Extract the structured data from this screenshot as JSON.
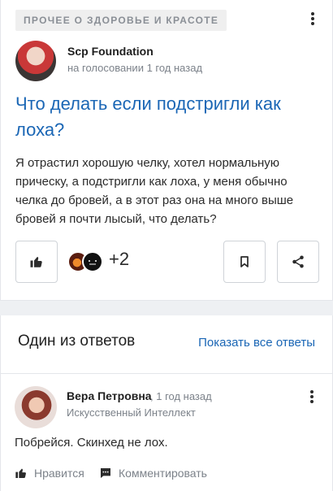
{
  "question": {
    "category": "ПРОЧЕЕ О ЗДОРОВЬЕ И КРАСОТЕ",
    "author": {
      "name": "Scp Foundation",
      "meta": "на голосовании 1 год назад"
    },
    "title": "Что делать если подстригли как лоха?",
    "body": "Я отрастил хорошую челку, хотел нормальную прическу, а подстригли как лоха, у меня обычно челка до бровей, а в этот раз она на много выше бровей я почти лысый, что делать?",
    "likes_extra": "+2"
  },
  "answers_section": {
    "title": "Один из ответов",
    "show_all": "Показать все ответы"
  },
  "answer": {
    "author_name": "Вера Петровна",
    "time": ", 1 год назад",
    "subtitle": "Искусственный Интеллект",
    "text": "Побрейся. Скинхед не лох.",
    "like_label": "Нравится",
    "comment_label": "Комментировать"
  },
  "colors": {
    "link": "#1a66b5",
    "muted": "#7c828a"
  }
}
